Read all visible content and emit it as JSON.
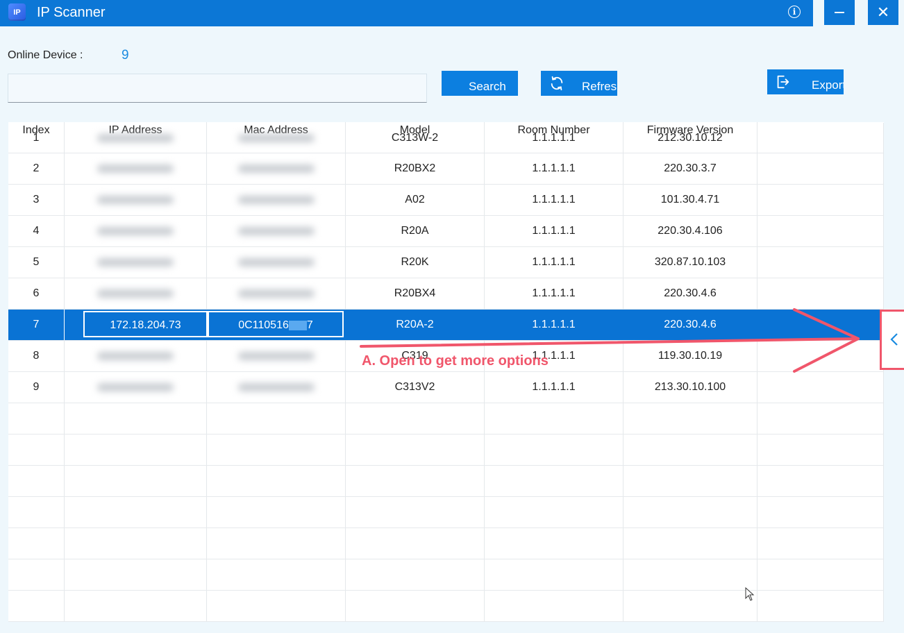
{
  "window": {
    "app_icon_text": "IP",
    "title": "IP Scanner",
    "info_icon": "i",
    "close_glyph": "✕"
  },
  "summary": {
    "online_label": "Online Device :",
    "online_count": "9"
  },
  "search": {
    "value": "",
    "placeholder": ""
  },
  "toolbar": {
    "search_label": "Search",
    "refresh_label": "Refresh",
    "export_label": "Export"
  },
  "table": {
    "columns": [
      "Index",
      "IP Address",
      "Mac Address",
      "Model",
      "Room Number",
      "Firmware Version"
    ],
    "rows": [
      {
        "index": "1",
        "model": "C313W-2",
        "room": "1.1.1.1.1",
        "firmware": "212.30.10.12"
      },
      {
        "index": "2",
        "model": "R20BX2",
        "room": "1.1.1.1.1",
        "firmware": "220.30.3.7"
      },
      {
        "index": "3",
        "model": "A02",
        "room": "1.1.1.1.1",
        "firmware": "101.30.4.71"
      },
      {
        "index": "4",
        "model": "R20A",
        "room": "1.1.1.1.1",
        "firmware": "220.30.4.106"
      },
      {
        "index": "5",
        "model": "R20K",
        "room": "1.1.1.1.1",
        "firmware": "320.87.10.103"
      },
      {
        "index": "6",
        "model": "R20BX4",
        "room": "1.1.1.1.1",
        "firmware": "220.30.4.6"
      },
      {
        "index": "7",
        "ip": "172.18.204.73",
        "mac_start": "0C110516",
        "mac_end": "7",
        "model": "R20A-2",
        "room": "1.1.1.1.1",
        "firmware": "220.30.4.6"
      },
      {
        "index": "8",
        "model": "C319",
        "room": "1.1.1.1.1",
        "firmware": "119.30.10.19"
      },
      {
        "index": "9",
        "model": "C313V2",
        "room": "1.1.1.1.1",
        "firmware": "213.30.10.100"
      }
    ]
  },
  "annotation": {
    "text": "A. Open to get more options",
    "color": "#f0566b"
  },
  "colors": {
    "titlebar": "#0c77d6",
    "button": "#0c7fe0",
    "selected_row": "#0a73d4",
    "count": "#1a8be0"
  }
}
